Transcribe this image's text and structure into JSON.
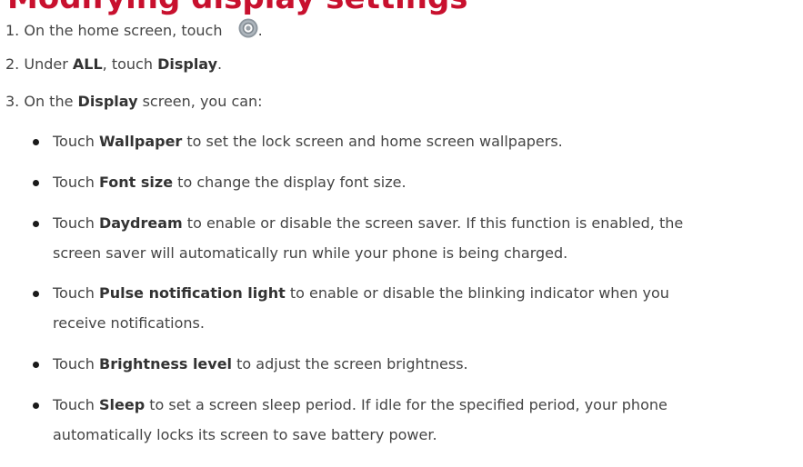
{
  "heading": "Modifying display settings",
  "steps": [
    {
      "num": "1.",
      "pre": "On the home screen, touch",
      "post": "."
    },
    {
      "num": "2.",
      "pre": "Under",
      "b1": "ALL",
      "mid": ", touch",
      "b2": "Display",
      "post": "."
    },
    {
      "num": "3.",
      "pre": "On the",
      "b1": "Display",
      "post": "screen, you can:"
    }
  ],
  "bullets": [
    {
      "pre": "Touch",
      "bold": "Wallpaper",
      "text": "to set the lock screen and home screen wallpapers."
    },
    {
      "pre": "Touch",
      "bold": "Font size",
      "text": "to change the display font size."
    },
    {
      "pre": "Touch",
      "bold": "Daydream",
      "text": "to enable or disable the screen saver. If this function is enabled, the",
      "cont": "screen saver will automatically run while your phone is being charged."
    },
    {
      "pre": "Touch",
      "bold": "Pulse notification light",
      "text": "to enable or disable the blinking indicator when you",
      "cont": "receive notifications."
    },
    {
      "pre": "Touch",
      "bold": "Brightness level",
      "text": "to adjust the screen brightness."
    },
    {
      "pre": "Touch",
      "bold": "Sleep",
      "text": "to set a screen sleep period. If idle for the specified period, your phone",
      "cont": "automatically locks its screen to save battery power."
    }
  ],
  "icons": {
    "settings": "settings-gear-icon"
  },
  "colors": {
    "heading": "#c8102e",
    "text": "#444444"
  }
}
